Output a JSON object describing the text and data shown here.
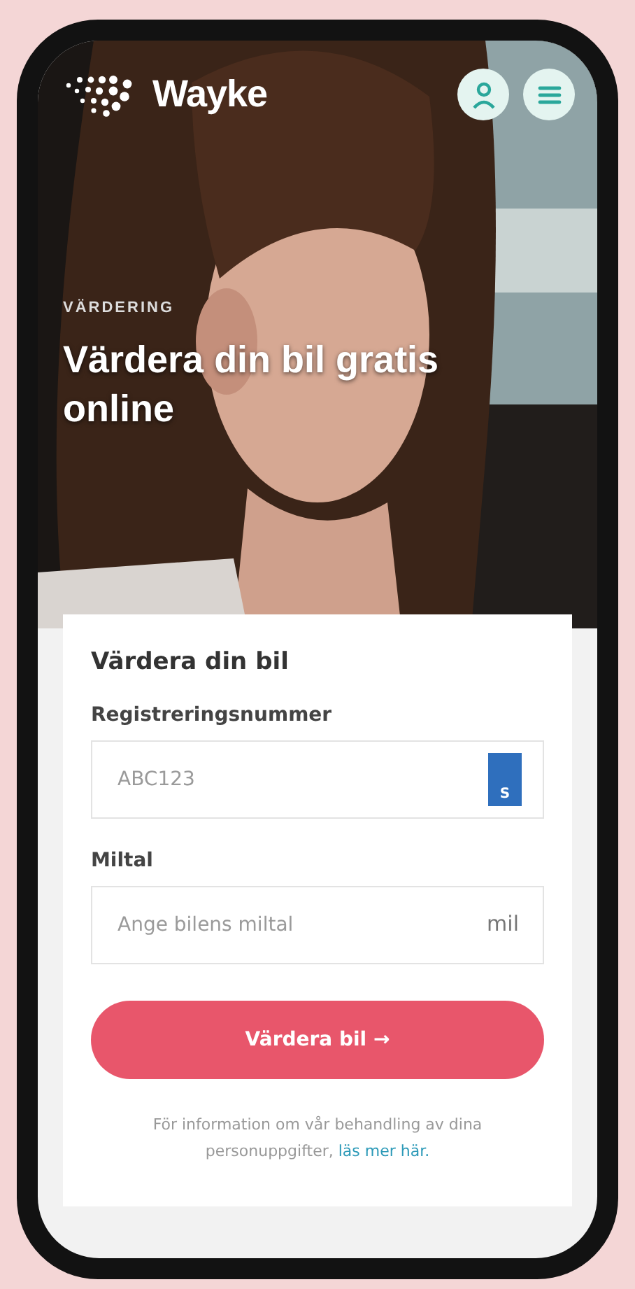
{
  "header": {
    "logo": "Wayke"
  },
  "hero": {
    "kicker": "VÄRDERING",
    "title": "Värdera din bil gratis online"
  },
  "form": {
    "title": "Värdera din bil",
    "fields": [
      {
        "kind": "plate",
        "label": "Registreringsnummer",
        "placeholder": "ABC123",
        "country": "S"
      },
      {
        "kind": "unit",
        "label": "Miltal",
        "placeholder": "Ange bilens miltal",
        "unit": "mil"
      }
    ],
    "submit": {
      "label": "Värdera bil",
      "arrow": "→"
    },
    "privacy": {
      "text": "För information om vår behandling av dina personuppgifter,",
      "link": "läs mer här."
    }
  }
}
